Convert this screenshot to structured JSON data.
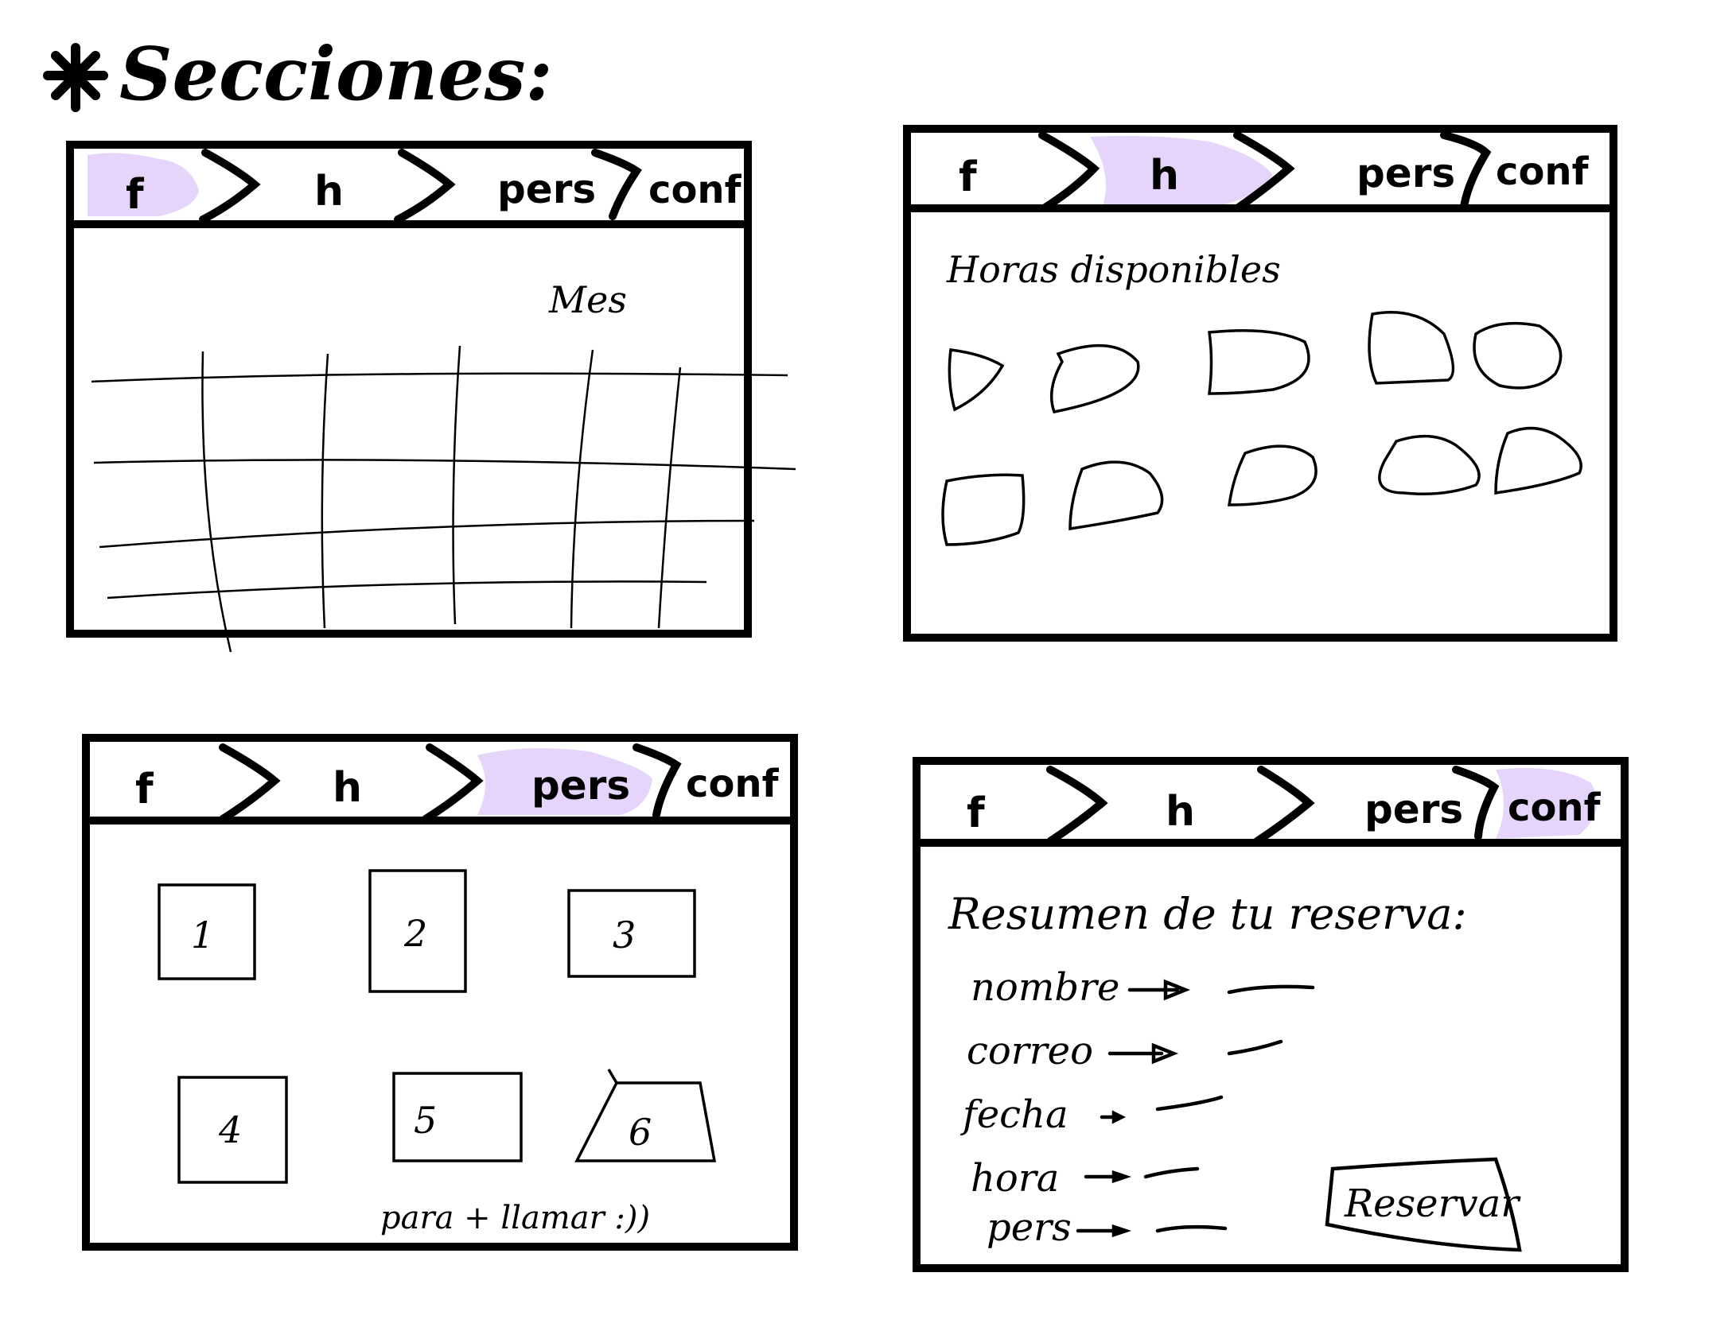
{
  "title": "Secciones:",
  "title_mark": "*",
  "colors": {
    "ink": "#000000",
    "highlight": "#e6d5fb",
    "paper": "#ffffff"
  },
  "tabs": [
    "f",
    "h",
    "pers",
    "conf"
  ],
  "panels": [
    {
      "id": "panel-fecha",
      "active_tab": 0,
      "heading": "Mes"
    },
    {
      "id": "panel-horas",
      "active_tab": 1,
      "heading": "Horas disponibles",
      "slot_count": 10
    },
    {
      "id": "panel-personas",
      "active_tab": 2,
      "tables": [
        "1",
        "2",
        "3",
        "4",
        "5",
        "6"
      ],
      "note": "para + llamar :))"
    },
    {
      "id": "panel-confirmacion",
      "active_tab": 3,
      "heading": "Resumen de tu reserva:",
      "fields": [
        "nombre",
        "correo",
        "fecha",
        "hora",
        "pers"
      ],
      "button": "Reservar"
    }
  ]
}
